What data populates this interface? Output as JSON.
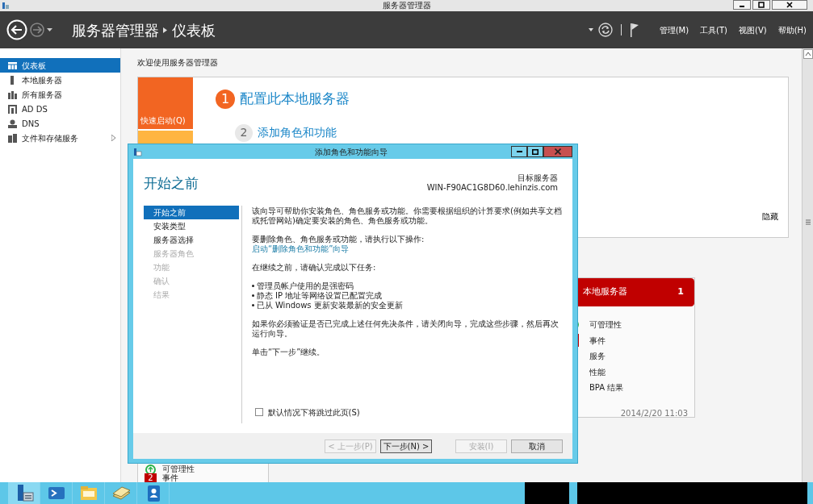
{
  "window": {
    "title": "服务器管理器"
  },
  "header": {
    "breadcrumb": [
      "服务器管理器",
      "仪表板"
    ],
    "menus": [
      "管理(M)",
      "工具(T)",
      "视图(V)",
      "帮助(H)"
    ]
  },
  "sidebar": {
    "items": [
      {
        "label": "仪表板",
        "selected": true,
        "expandable": false
      },
      {
        "label": "本地服务器",
        "selected": false,
        "expandable": false
      },
      {
        "label": "所有服务器",
        "selected": false,
        "expandable": false
      },
      {
        "label": "AD DS",
        "selected": false,
        "expandable": false
      },
      {
        "label": "DNS",
        "selected": false,
        "expandable": false
      },
      {
        "label": "文件和存储服务",
        "selected": false,
        "expandable": true
      }
    ]
  },
  "welcome": {
    "title": "欢迎使用服务器管理器",
    "quick_start": "快速启动(Q)",
    "steps": [
      {
        "number": "1",
        "label": "配置此本地服务器",
        "current": true
      },
      {
        "number": "2",
        "label": "添加角色和功能",
        "current": false
      }
    ],
    "hide": "隐藏"
  },
  "tiles": [
    {
      "title": "本地服务器",
      "count": "1",
      "alert": true,
      "rows": [
        {
          "label": "可管理性",
          "kind": "ok"
        },
        {
          "label": "事件",
          "kind": "alert"
        },
        {
          "label": "服务",
          "kind": "plain"
        },
        {
          "label": "性能",
          "kind": "plain"
        },
        {
          "label": "BPA 结果",
          "kind": "plain"
        }
      ],
      "timestamp": "2014/2/20 11:03"
    },
    {
      "rows": [
        {
          "label": "可管理性",
          "kind": "ok"
        },
        {
          "label": "事件",
          "kind": "count",
          "count": "2"
        }
      ]
    }
  ],
  "dialog": {
    "title": "添加角色和功能向导",
    "heading": "开始之前",
    "target_label": "目标服务器",
    "target_server": "WIN-F90AC1G8D60.lehinzis.com",
    "steps": [
      {
        "label": "开始之前",
        "selected": true,
        "disabled": false
      },
      {
        "label": "安装类型",
        "selected": false,
        "disabled": false
      },
      {
        "label": "服务器选择",
        "selected": false,
        "disabled": false
      },
      {
        "label": "服务器角色",
        "selected": false,
        "disabled": true
      },
      {
        "label": "功能",
        "selected": false,
        "disabled": true
      },
      {
        "label": "确认",
        "selected": false,
        "disabled": true
      },
      {
        "label": "结果",
        "selected": false,
        "disabled": true
      }
    ],
    "body": [
      {
        "kind": "text",
        "text": "该向导可帮助你安装角色、角色服务或功能。你需要根据组织的计算要求(例如共享文档或托管网站)确定要安装的角色、角色服务或功能。"
      },
      {
        "kind": "text",
        "text": "要删除角色、角色服务或功能，请执行以下操作:"
      },
      {
        "kind": "link",
        "text": "启动“删除角色和功能”向导"
      },
      {
        "kind": "text",
        "text": "在继续之前，请确认完成以下任务:"
      },
      {
        "kind": "bullets",
        "items": [
          "管理员帐户使用的是强密码",
          "静态 IP 地址等网络设置已配置完成",
          "已从 Windows 更新安装最新的安全更新"
        ]
      },
      {
        "kind": "text",
        "text": "如果你必须验证是否已完成上述任何先决条件，请关闭向导，完成这些步骤，然后再次运行向导。"
      },
      {
        "kind": "text",
        "text": "单击“下一步”继续。"
      }
    ],
    "skip_checkbox": {
      "label": "默认情况下将跳过此页(S)",
      "checked": false
    },
    "buttons": [
      {
        "label": "< 上一步(P)",
        "disabled": true,
        "default": false
      },
      {
        "label": "下一步(N) >",
        "disabled": false,
        "default": true
      },
      {
        "label": "安装(I)",
        "disabled": true,
        "default": false
      },
      {
        "label": "取消",
        "disabled": false,
        "default": false
      }
    ]
  },
  "taskbar": {
    "apps": [
      {
        "selected": true
      },
      {
        "selected": false
      },
      {
        "selected": false
      },
      {
        "selected": false
      },
      {
        "selected": false
      }
    ]
  }
}
